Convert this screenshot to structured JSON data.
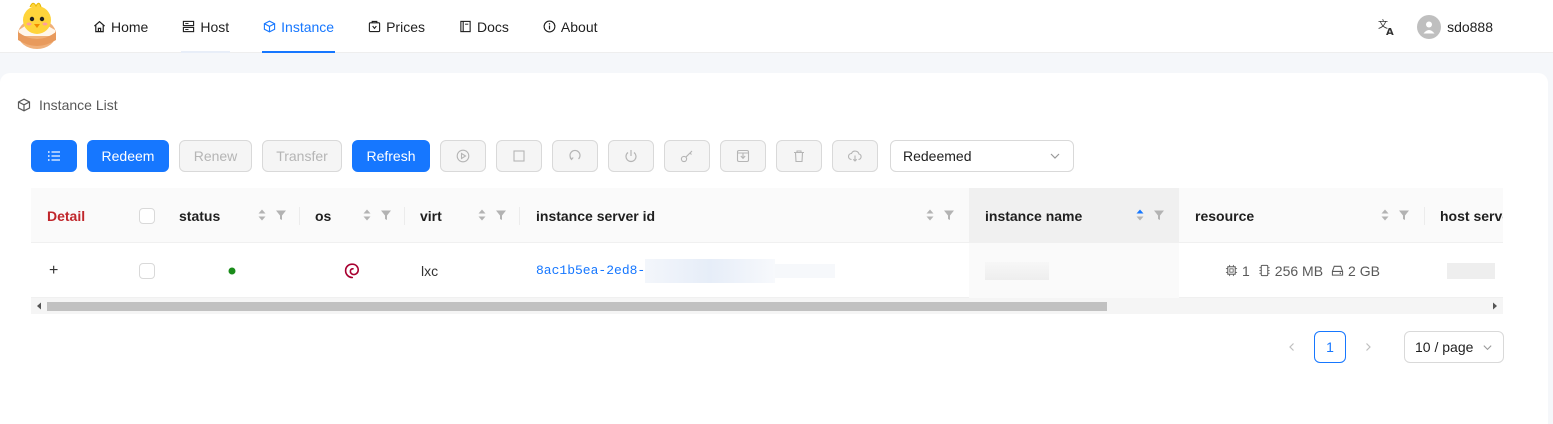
{
  "nav": {
    "items": [
      {
        "label": "Home",
        "icon": "home-icon"
      },
      {
        "label": "Host",
        "icon": "server-icon"
      },
      {
        "label": "Instance",
        "icon": "cube-icon",
        "active": true
      },
      {
        "label": "Prices",
        "icon": "price-tag-icon"
      },
      {
        "label": "Docs",
        "icon": "book-icon"
      },
      {
        "label": "About",
        "icon": "info-icon"
      }
    ]
  },
  "user": {
    "name": "sdo888"
  },
  "page": {
    "title": "Instance List"
  },
  "toolbar": {
    "redeem": "Redeem",
    "renew": "Renew",
    "transfer": "Transfer",
    "refresh": "Refresh",
    "filter_value": "Redeemed"
  },
  "table": {
    "headers": {
      "detail": "Detail",
      "status": "status",
      "os": "os",
      "virt": "virt",
      "server_id": "instance server id",
      "name": "instance name",
      "resource": "resource",
      "host": "host serve"
    },
    "rows": [
      {
        "expand": "+",
        "status_color": "#1a8c1a",
        "os_icon": "debian-icon",
        "virt": "lxc",
        "server_id": "8ac1b5ea-2ed8-",
        "cpu": "1",
        "memory": "256 MB",
        "disk": "2 GB"
      }
    ]
  },
  "pagination": {
    "current": "1",
    "page_size": "10 / page"
  },
  "colors": {
    "primary": "#1677ff",
    "detail_header": "#c0262b",
    "status_running": "#1a8c1a",
    "debian": "#a80030"
  }
}
